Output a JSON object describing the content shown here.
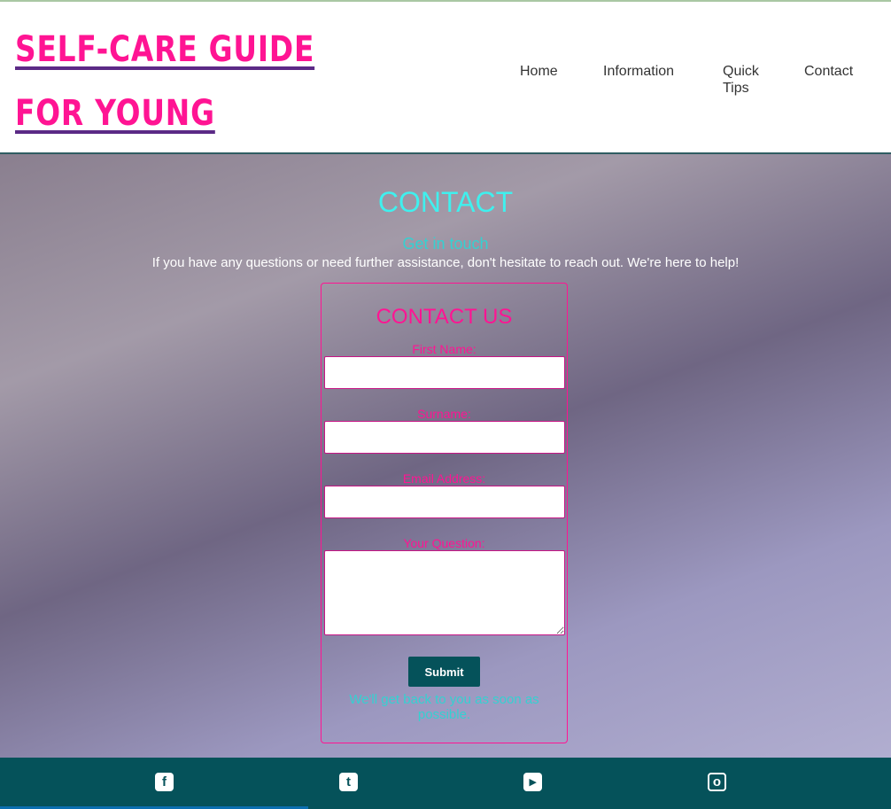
{
  "header": {
    "title": "SELF-CARE GUIDE FOR YOUNG WOMAN",
    "nav": [
      "Home",
      "Information",
      "Quick Tips",
      "Contact"
    ]
  },
  "hero": {
    "heading": "CONTACT",
    "subheading": "Get in touch",
    "intro": "If you have any questions or need further assistance, don't hesitate to reach out. We're here to help!"
  },
  "form": {
    "title": "CONTACT US",
    "labels": [
      "First Name:",
      "Surname:",
      "Email Address:",
      "Your Question:"
    ],
    "submit": "Submit",
    "note": "We'll get back to you as soon as possible."
  },
  "footer": {
    "icons": [
      "facebook-icon",
      "twitter-icon",
      "youtube-icon",
      "instagram-icon"
    ]
  }
}
